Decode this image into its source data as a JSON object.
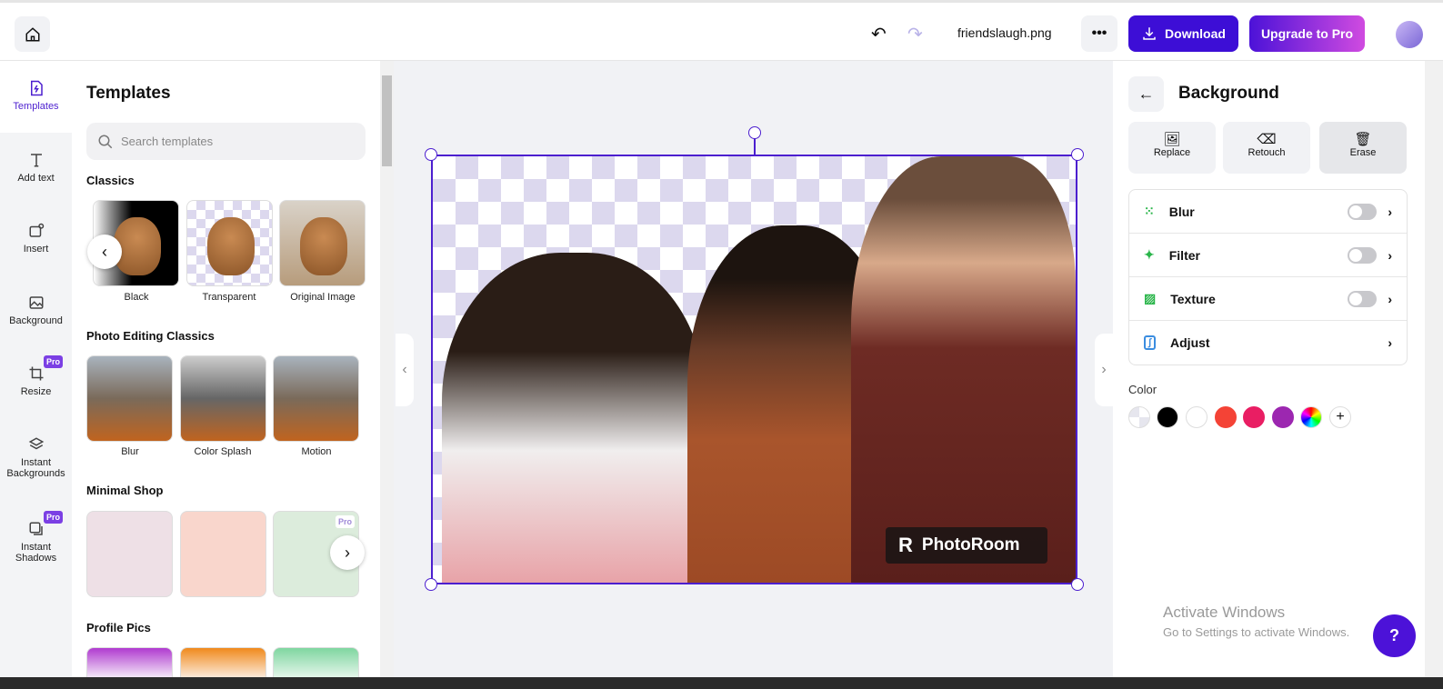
{
  "topbar": {
    "filename": "friendslaugh.png",
    "download_label": "Download",
    "upgrade_label": "Upgrade to Pro",
    "colors": {
      "download": "#3d0ed6",
      "upgrade_from": "#4c12d8",
      "upgrade_to": "#d04be0"
    }
  },
  "rail": {
    "items": [
      {
        "label": "Templates",
        "active": true
      },
      {
        "label": "Add text"
      },
      {
        "label": "Insert"
      },
      {
        "label": "Background"
      },
      {
        "label": "Resize",
        "badge": "Pro"
      },
      {
        "label": "Instant Backgrounds"
      },
      {
        "label": "Instant Shadows",
        "badge": "Pro"
      }
    ]
  },
  "templates": {
    "title": "Templates",
    "search_placeholder": "Search templates",
    "sections": [
      {
        "title": "Classics",
        "items": [
          "Black",
          "Transparent",
          "Original Image"
        ]
      },
      {
        "title": "Photo Editing Classics",
        "items": [
          "Blur",
          "Color Splash",
          "Motion"
        ]
      },
      {
        "title": "Minimal Shop",
        "badge": "Pro"
      },
      {
        "title": "Profile Pics"
      }
    ]
  },
  "canvas": {
    "watermark": "PhotoRoom"
  },
  "right": {
    "title": "Background",
    "tools": [
      "Replace",
      "Retouch",
      "Erase"
    ],
    "options": [
      {
        "label": "Blur",
        "toggle": false
      },
      {
        "label": "Filter",
        "toggle": false
      },
      {
        "label": "Texture",
        "toggle": false
      },
      {
        "label": "Adjust"
      }
    ],
    "color_label": "Color",
    "swatches": [
      "transparent",
      "#000000",
      "#ffffff",
      "#f44336",
      "#e91e63",
      "#9c27b0",
      "rainbow"
    ]
  },
  "windows": {
    "line1": "Activate Windows",
    "line2": "Go to Settings to activate Windows."
  }
}
